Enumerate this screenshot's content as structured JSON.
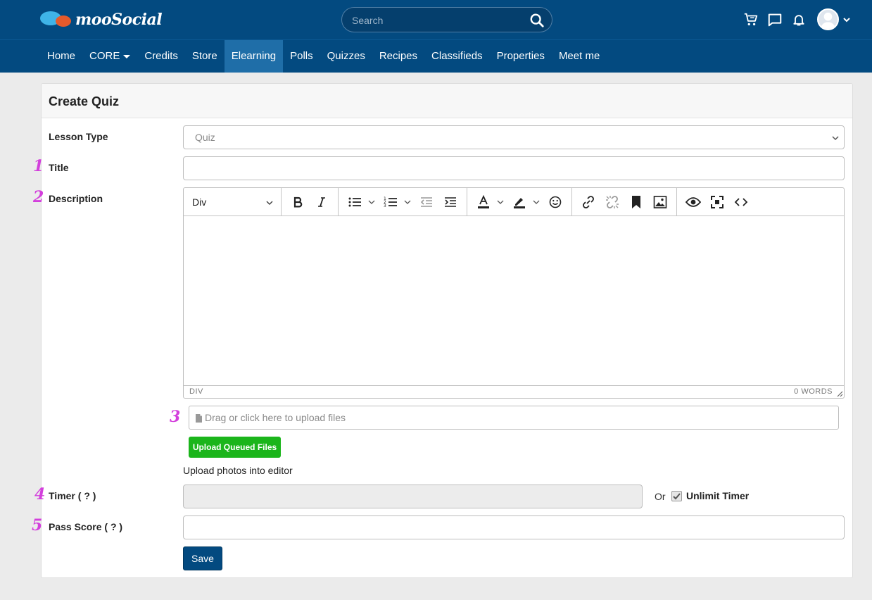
{
  "brand": {
    "name": "mooSocial"
  },
  "search": {
    "placeholder": "Search"
  },
  "header_icons": [
    "cart-icon",
    "chat-icon",
    "bell-icon",
    "user-avatar-icon"
  ],
  "nav": {
    "items": [
      {
        "label": "Home"
      },
      {
        "label": "CORE",
        "has_dropdown": true
      },
      {
        "label": "Credits"
      },
      {
        "label": "Store"
      },
      {
        "label": "Elearning",
        "active": true
      },
      {
        "label": "Polls"
      },
      {
        "label": "Quizzes"
      },
      {
        "label": "Recipes"
      },
      {
        "label": "Classifieds"
      },
      {
        "label": "Properties"
      },
      {
        "label": "Meet me"
      }
    ]
  },
  "form": {
    "title": "Create Quiz",
    "lesson_type": {
      "label": "Lesson Type",
      "value": "Quiz"
    },
    "title_field": {
      "label": "Title",
      "value": ""
    },
    "description": {
      "label": "Description"
    },
    "editor": {
      "block_format": "Div",
      "status_path": "DIV",
      "word_count": "0 WORDS"
    },
    "upload": {
      "placeholder": "Drag or click here to upload files"
    },
    "upload_button": "Upload Queued Files",
    "upload_helper": "Upload photos into editor",
    "timer": {
      "label": "Timer ( ? )",
      "value": "",
      "or_text": "Or",
      "unlimit_label": "Unlimit Timer",
      "unlimit_checked": true
    },
    "pass_score": {
      "label": "Pass Score ( ? )",
      "value": ""
    },
    "save_button": "Save"
  },
  "annotations": [
    "1",
    "2",
    "3",
    "4",
    "5"
  ],
  "colors": {
    "header": "#034a80",
    "nav_active": "#1f6ea8",
    "green_button": "#1bb51b",
    "marker": "#d33fdc"
  }
}
